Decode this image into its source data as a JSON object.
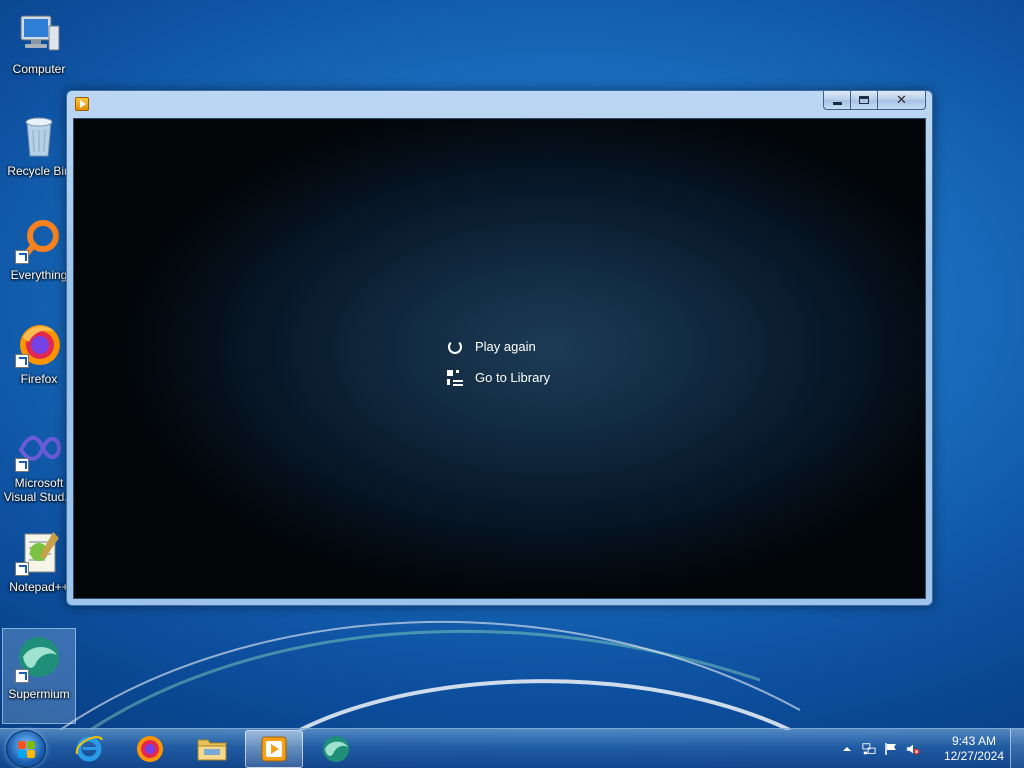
{
  "desktop": {
    "icons": [
      {
        "label": "Computer"
      },
      {
        "label": "Recycle Bin"
      },
      {
        "label": "Everything"
      },
      {
        "label": "Firefox"
      },
      {
        "label": "Microsoft Visual Stud..."
      },
      {
        "label": "Notepad++"
      },
      {
        "label": "Supermium"
      }
    ]
  },
  "window": {
    "app_icon": "media-player-icon",
    "menu": {
      "play_again": "Play again",
      "go_to_library": "Go to Library"
    },
    "caption": {
      "minimize": "minimize-icon",
      "maximize": "maximize-icon",
      "close": "close-icon"
    }
  },
  "taskbar": {
    "pinned": [
      "Internet Explorer",
      "Firefox",
      "File Explorer",
      "Media Player",
      "Supermium"
    ],
    "active": "Media Player",
    "tray": {
      "time": "9:43 AM",
      "date": "12/27/2024",
      "icons": [
        "show-hidden-icons-arrow",
        "network-icon",
        "action-center-flag-icon",
        "volume-muted-icon"
      ]
    }
  },
  "colors": {
    "wallpaper": "#1a6fc0",
    "window_frame": "#9cc2ea",
    "player_bg": "#08182a"
  }
}
